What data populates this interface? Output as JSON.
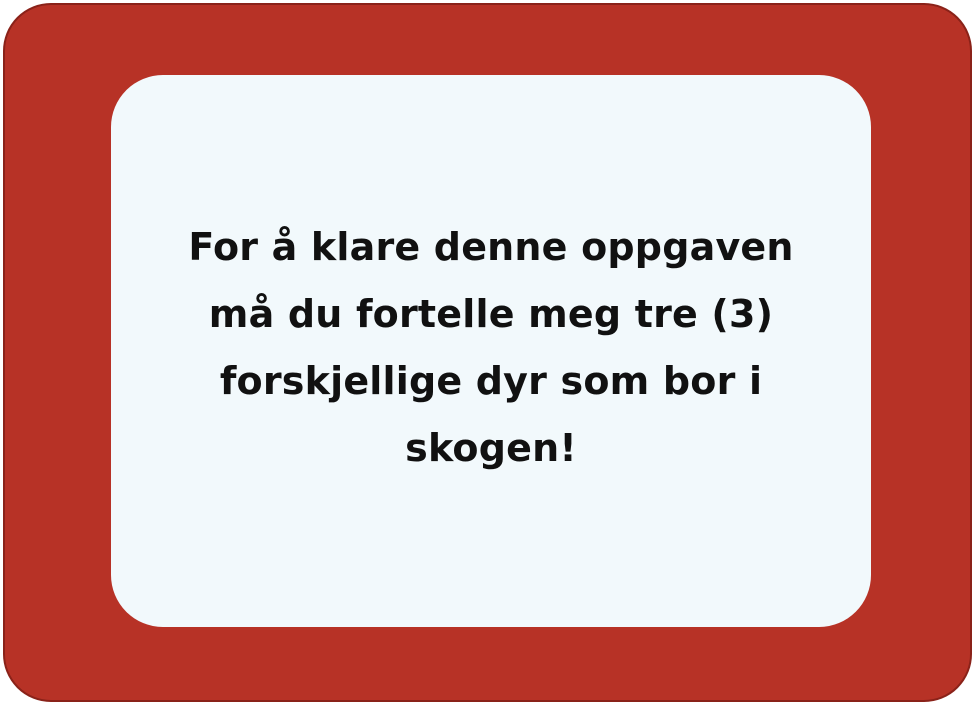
{
  "card": {
    "message": "For å klare denne oppgaven må du fortelle meg tre (3) forskjellige dyr som bor i skogen!"
  },
  "colors": {
    "frame": "#b73226",
    "card": "#f2f9fc",
    "text": "#111111"
  }
}
